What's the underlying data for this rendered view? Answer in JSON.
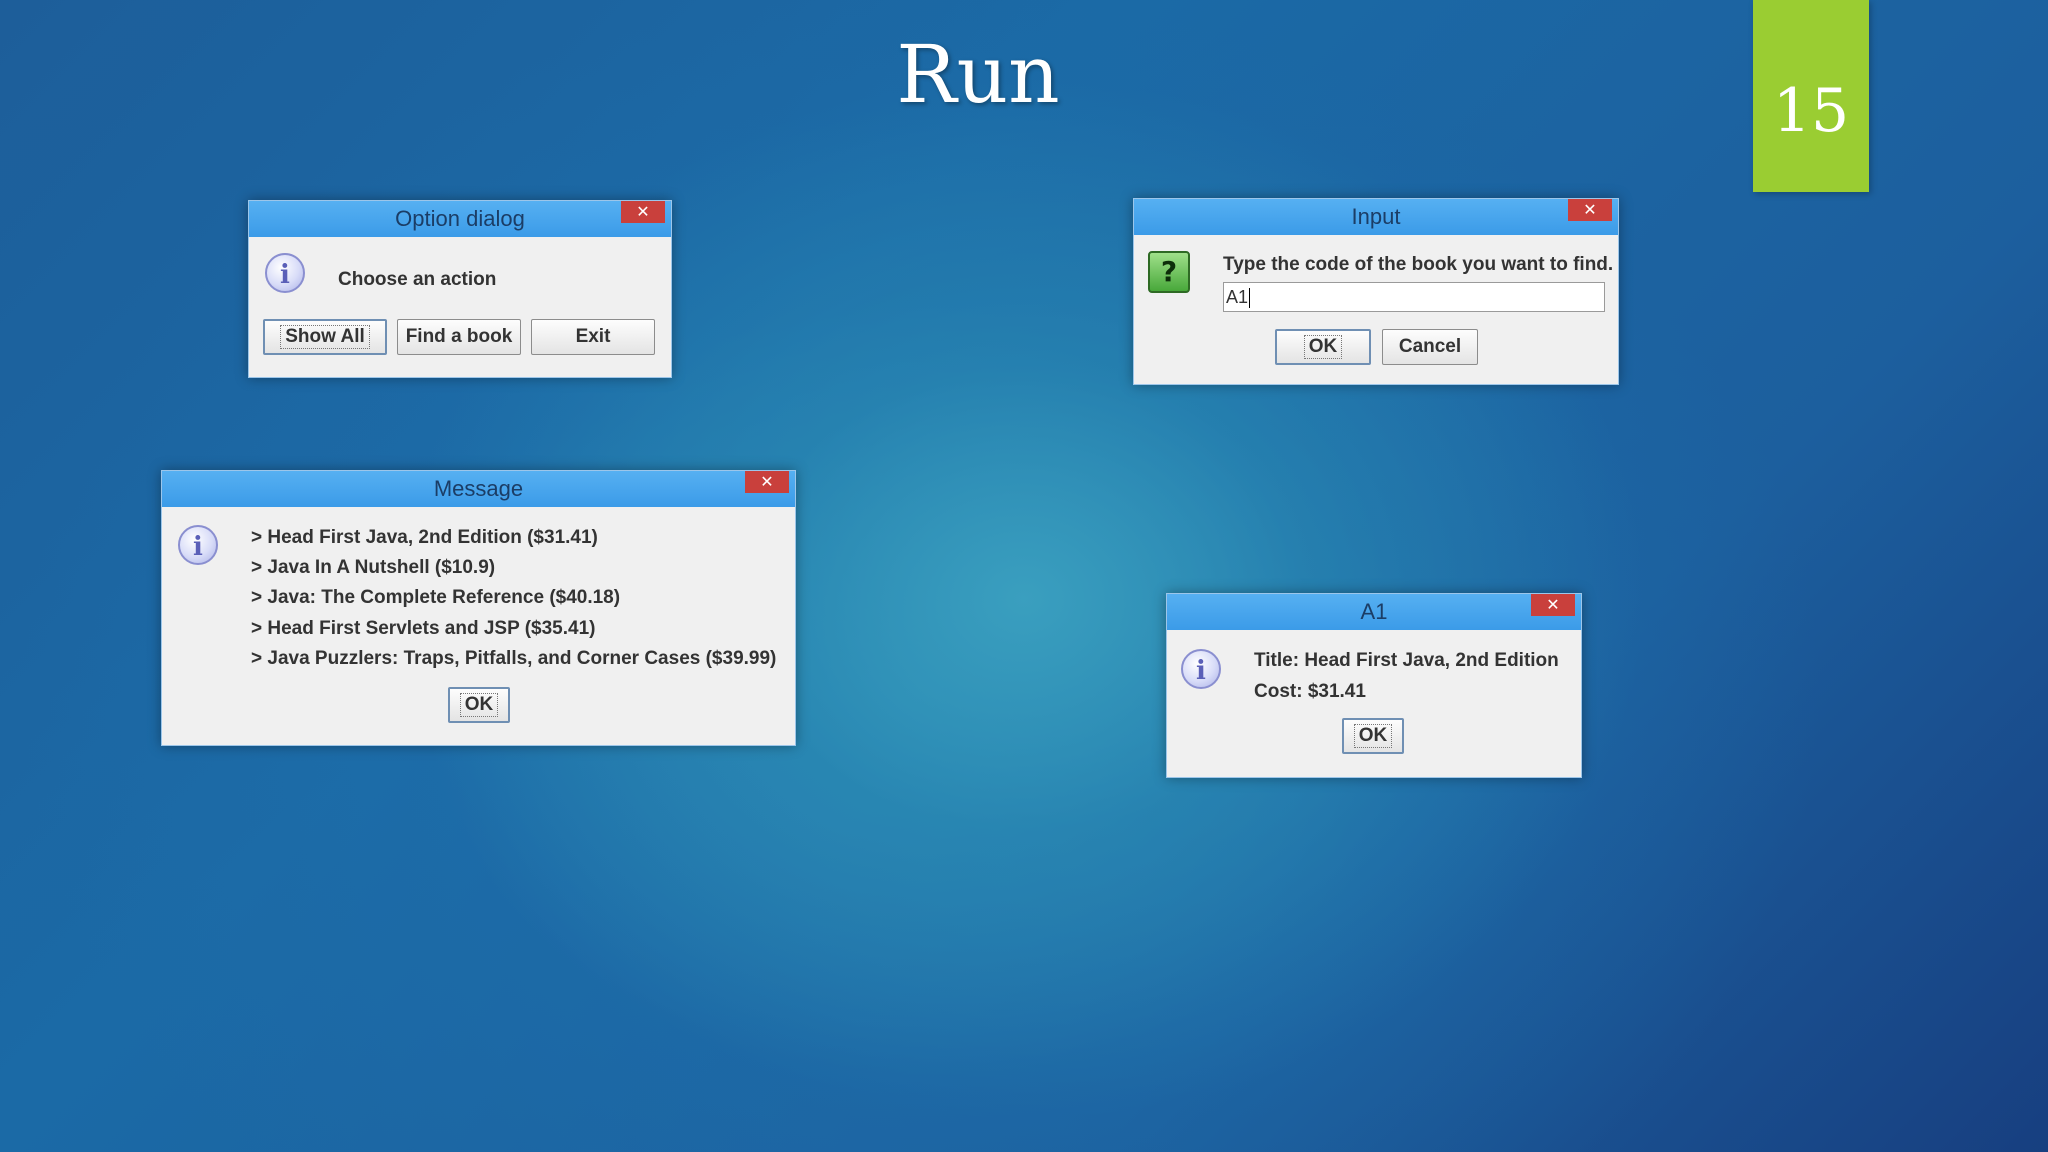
{
  "slide": {
    "title": "Run",
    "page_number": "15"
  },
  "option_dialog": {
    "title": "Option dialog",
    "close_glyph": "✕",
    "icon": "info-icon",
    "message": "Choose an action",
    "buttons": [
      "Show All",
      "Find a book",
      "Exit"
    ]
  },
  "input_dialog": {
    "title": "Input",
    "close_glyph": "✕",
    "icon": "question-icon",
    "icon_glyph": "?",
    "prompt": "Type the code of the book you want to find.",
    "input_value": "A1",
    "ok_label": "OK",
    "cancel_label": "Cancel"
  },
  "message_dialog": {
    "title": "Message",
    "close_glyph": "✕",
    "icon": "info-icon",
    "items": [
      "> Head First Java, 2nd Edition ($31.41)",
      "> Java In A Nutshell ($10.9)",
      "> Java: The Complete Reference ($40.18)",
      "> Head First Servlets and JSP ($35.41)",
      "> Java Puzzlers: Traps, Pitfalls, and Corner Cases ($39.99)"
    ],
    "ok_label": "OK"
  },
  "a1_dialog": {
    "title": "A1",
    "close_glyph": "✕",
    "icon": "info-icon",
    "title_line": "Title: Head First Java, 2nd Edition",
    "cost_line": "Cost: $31.41",
    "ok_label": "OK"
  },
  "colors": {
    "titlebar": "#3b9be8",
    "close_button": "#c9403c",
    "badge": "#9acd32"
  }
}
